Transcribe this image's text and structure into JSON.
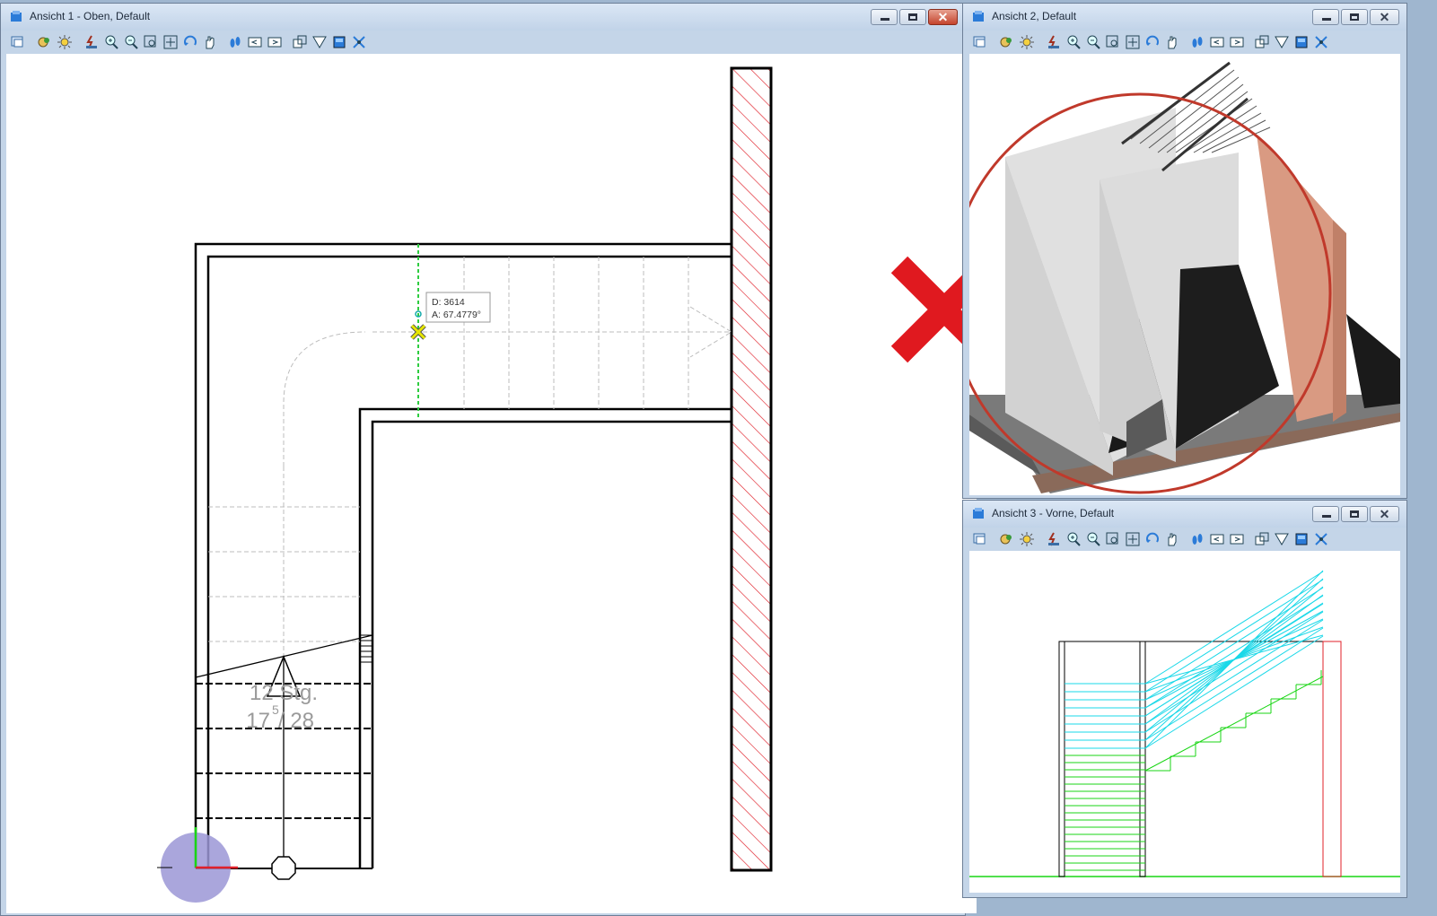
{
  "windows": {
    "top": {
      "title": "Ansicht 1 - Oben, Default"
    },
    "iso": {
      "title": "Ansicht 2, Default"
    },
    "front": {
      "title": "Ansicht 3 - Vorne, Default"
    }
  },
  "window_controls": {
    "minimize": "minimize-icon",
    "maximize": "maximize-icon",
    "close": "close-icon"
  },
  "tooltip": {
    "distance": "D:  3614",
    "angle": "A:  67.4779°"
  },
  "stair_label": {
    "steps": "12 Stg.",
    "ratio_main": "17",
    "ratio_sup": "5",
    "ratio_rest": " / 28"
  },
  "toolbar_icons": [
    "view-attributes-icon",
    "view-display-mode-icon",
    "lighting-icon",
    "update-view-icon",
    "zoom-in-icon",
    "zoom-out-icon",
    "window-area-icon",
    "fit-view-icon",
    "rotate-view-icon",
    "pan-icon",
    "walk-icon",
    "previous-view-icon",
    "next-view-icon",
    "copy-view-icon",
    "clip-volume-icon",
    "view-toggles-icon",
    "render-icon"
  ],
  "colors": {
    "hatch": "#e0202a",
    "cyan": "#1ad8e8",
    "green": "#19d614",
    "red_x": "#e0191f",
    "circle": "#c0392b"
  }
}
